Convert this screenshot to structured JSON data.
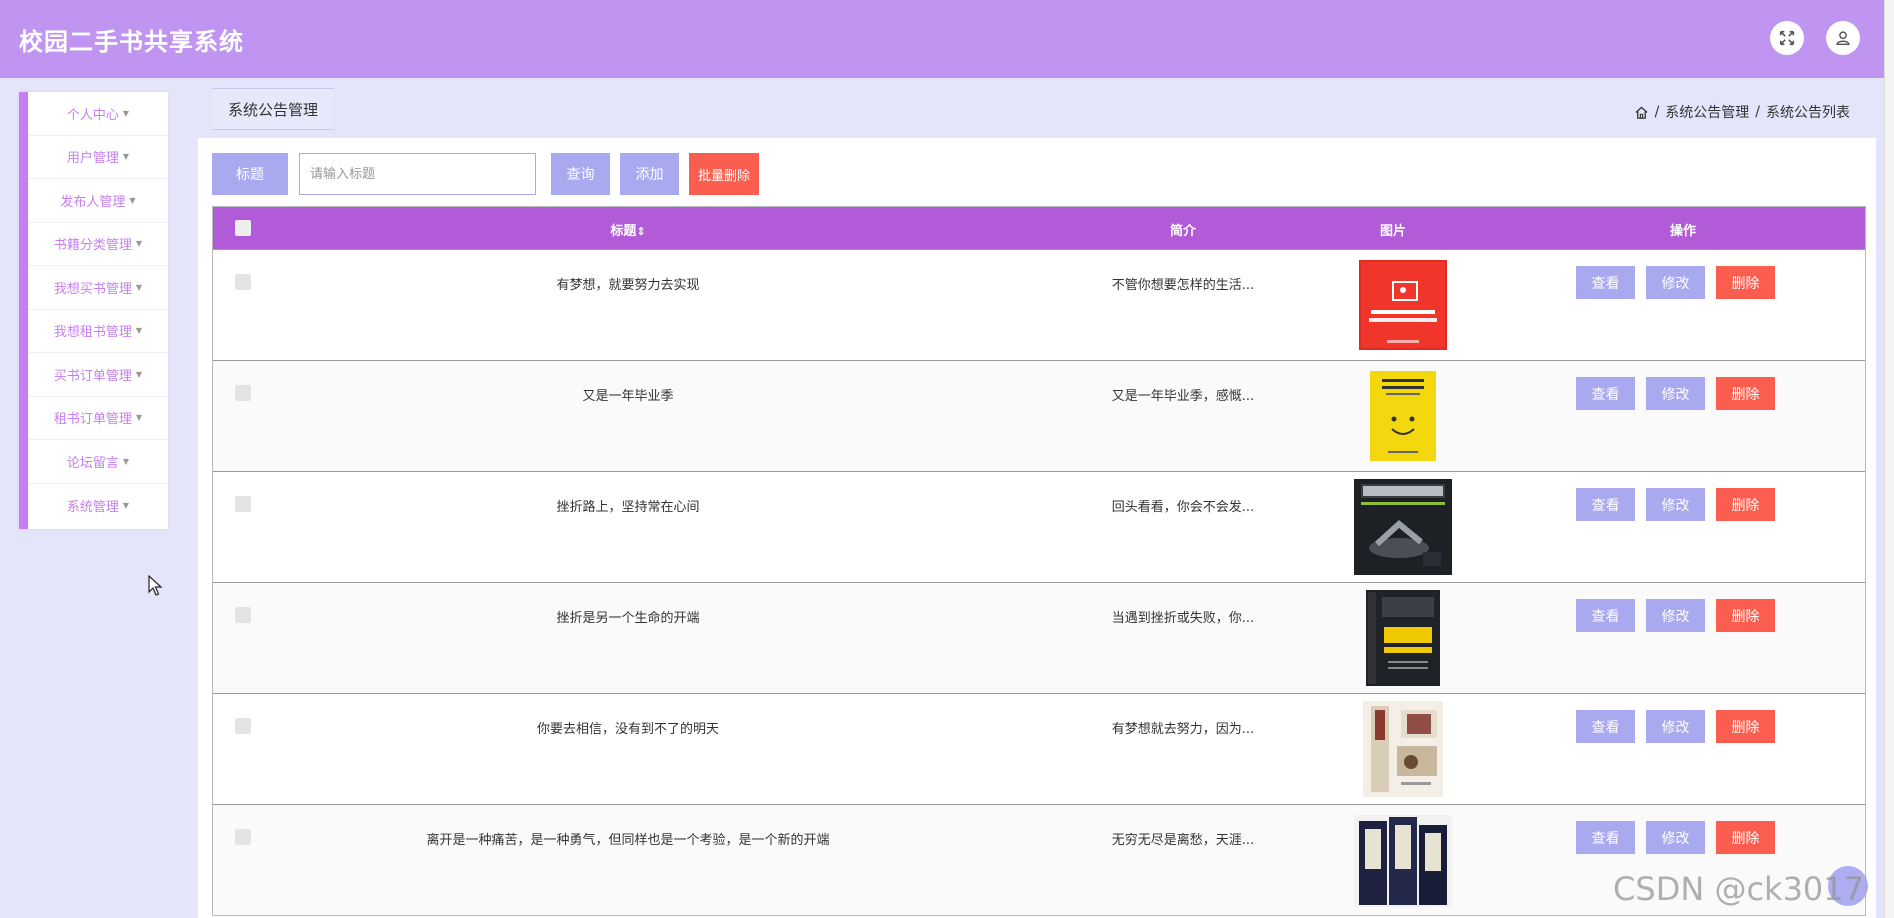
{
  "header": {
    "title": "校园二手书共享系统"
  },
  "sidebar": {
    "items": [
      {
        "label": "个人中心"
      },
      {
        "label": "用户管理"
      },
      {
        "label": "发布人管理"
      },
      {
        "label": "书籍分类管理"
      },
      {
        "label": "我想买书管理"
      },
      {
        "label": "我想租书管理"
      },
      {
        "label": "买书订单管理"
      },
      {
        "label": "租书订单管理"
      },
      {
        "label": "论坛留言"
      },
      {
        "label": "系统管理"
      }
    ]
  },
  "tab": {
    "label": "系统公告管理"
  },
  "breadcrumb": {
    "level1": "系统公告管理",
    "sep": "/",
    "level2": "系统公告列表"
  },
  "toolbar": {
    "field_label": "标题",
    "search_placeholder": "请输入标题",
    "query_label": "查询",
    "add_label": "添加",
    "batch_delete_label": "批量删除"
  },
  "table": {
    "headers": {
      "title": "标题",
      "sort_glyph": "⇕",
      "intro": "简介",
      "image": "图片",
      "ops": "操作"
    },
    "actions": {
      "view": "查看",
      "edit": "修改",
      "delete": "删除"
    },
    "rows": [
      {
        "title": "有梦想，就要努力去实现",
        "intro": "不管你想要怎样的生活...",
        "cover": "red-book-cover"
      },
      {
        "title": "又是一年毕业季",
        "intro": "又是一年毕业季，感慨...",
        "cover": "yellow-book-cover"
      },
      {
        "title": "挫折路上，坚持常在心间",
        "intro": "回头看看，你会不会发...",
        "cover": "fitness-book-cover"
      },
      {
        "title": "挫折是另一个生命的开端",
        "intro": "当遇到挫折或失败，你...",
        "cover": "management-book-cover"
      },
      {
        "title": "你要去相信，没有到不了的明天",
        "intro": "有梦想就去努力，因为...",
        "cover": "dizigui-book-cover"
      },
      {
        "title": "离开是一种痛苦，是一种勇气，但同样也是一个考验，是一个新的开端",
        "intro": "无穷无尽是离愁，天涯...",
        "cover": "classic-set-cover"
      }
    ]
  },
  "watermark": "CSDN @ck3017",
  "colors": {
    "header": "#c095f2",
    "accent": "#c67ff0",
    "table_head": "#b15bd8",
    "button": "#a9a9f0",
    "danger": "#fb5e4e"
  }
}
